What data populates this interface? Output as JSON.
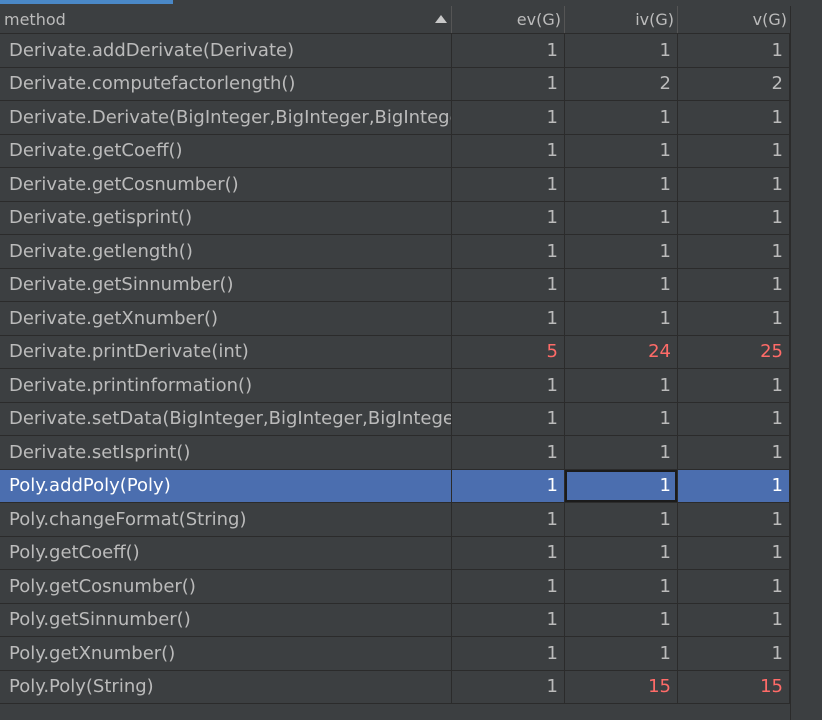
{
  "header": {
    "method": "method",
    "ev": "ev(G)",
    "iv": "iv(G)",
    "v": "v(G)"
  },
  "rows": [
    {
      "method": "Derivate.addDerivate(Derivate)",
      "ev": "1",
      "iv": "1",
      "v": "1"
    },
    {
      "method": "Derivate.computefactorlength()",
      "ev": "1",
      "iv": "2",
      "v": "2"
    },
    {
      "method": "Derivate.Derivate(BigInteger,BigInteger,BigInteger,B",
      "ev": "1",
      "iv": "1",
      "v": "1"
    },
    {
      "method": "Derivate.getCoeff()",
      "ev": "1",
      "iv": "1",
      "v": "1"
    },
    {
      "method": "Derivate.getCosnumber()",
      "ev": "1",
      "iv": "1",
      "v": "1"
    },
    {
      "method": "Derivate.getisprint()",
      "ev": "1",
      "iv": "1",
      "v": "1"
    },
    {
      "method": "Derivate.getlength()",
      "ev": "1",
      "iv": "1",
      "v": "1"
    },
    {
      "method": "Derivate.getSinnumber()",
      "ev": "1",
      "iv": "1",
      "v": "1"
    },
    {
      "method": "Derivate.getXnumber()",
      "ev": "1",
      "iv": "1",
      "v": "1"
    },
    {
      "method": "Derivate.printDerivate(int)",
      "ev": "5",
      "iv": "24",
      "v": "25"
    },
    {
      "method": "Derivate.printinformation()",
      "ev": "1",
      "iv": "1",
      "v": "1"
    },
    {
      "method": "Derivate.setData(BigInteger,BigInteger,BigInteger,B",
      "ev": "1",
      "iv": "1",
      "v": "1"
    },
    {
      "method": "Derivate.setIsprint()",
      "ev": "1",
      "iv": "1",
      "v": "1"
    },
    {
      "method": "Poly.addPoly(Poly)",
      "ev": "1",
      "iv": "1",
      "v": "1"
    },
    {
      "method": "Poly.changeFormat(String)",
      "ev": "1",
      "iv": "1",
      "v": "1"
    },
    {
      "method": "Poly.getCoeff()",
      "ev": "1",
      "iv": "1",
      "v": "1"
    },
    {
      "method": "Poly.getCosnumber()",
      "ev": "1",
      "iv": "1",
      "v": "1"
    },
    {
      "method": "Poly.getSinnumber()",
      "ev": "1",
      "iv": "1",
      "v": "1"
    },
    {
      "method": "Poly.getXnumber()",
      "ev": "1",
      "iv": "1",
      "v": "1"
    },
    {
      "method": "Poly.Poly(String)",
      "ev": "1",
      "iv": "15",
      "v": "15"
    }
  ],
  "colors": {
    "background": "#3c3f41",
    "text": "#bbbbbb",
    "selection": "#4b6eaf",
    "highlight_value": "#ff6b68",
    "accent_tab": "#4a88c7"
  }
}
